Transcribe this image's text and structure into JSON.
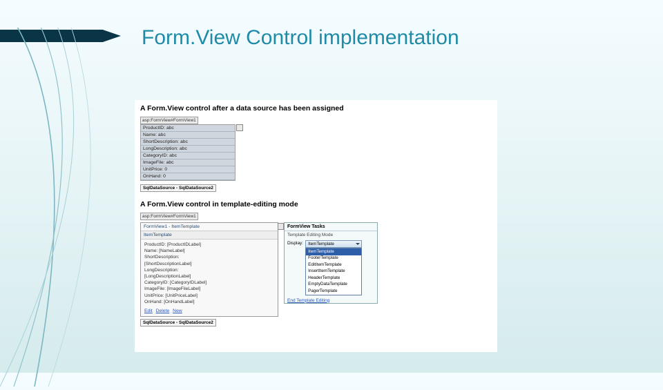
{
  "title": "Form.View Control implementation",
  "caption1": "A Form.View control after a data source has been assigned",
  "fv1": {
    "tagline": "asp:FormView#FormView1",
    "rows": [
      "ProductID: abc",
      "Name: abc",
      "ShortDescription: abc",
      "LongDescription: abc",
      "CategoryID: abc",
      "ImageFile: abc",
      "UnitPrice: 0",
      "OnHand: 0"
    ],
    "datasource": "SqlDataSource - SqlDataSource2"
  },
  "caption2": "A Form.View control in template-editing mode",
  "fv2": {
    "tagline": "asp:FormView#FormView1",
    "title": "FormView1 - ItemTemplate",
    "tmplheader": "ItemTemplate",
    "rows": [
      "ProductID: [ProductIDLabel]",
      "Name: [NameLabel]",
      "ShortDescription:",
      "[ShortDescriptionLabel]",
      "LongDescription:",
      "[LongDescriptionLabel]",
      "CategoryID: [CategoryIDLabel]",
      "ImageFile: [ImageFileLabel]",
      "UnitPrice: [UnitPriceLabel]",
      "OnHand: [OnHandLabel]"
    ],
    "links": {
      "edit": "Edit",
      "delete": "Delete",
      "new": "New"
    },
    "datasource": "SqlDataSource - SqlDataSource2"
  },
  "tasks": {
    "header": "FormView Tasks",
    "mode": "Template Editing Mode",
    "displayLabel": "Display:",
    "selected": "ItemTemplate",
    "options": [
      "ItemTemplate",
      "FooterTemplate",
      "EditItemTemplate",
      "InsertItemTemplate",
      "HeaderTemplate",
      "EmptyDataTemplate",
      "PagerTemplate"
    ],
    "endLink": "End Template Editing"
  }
}
